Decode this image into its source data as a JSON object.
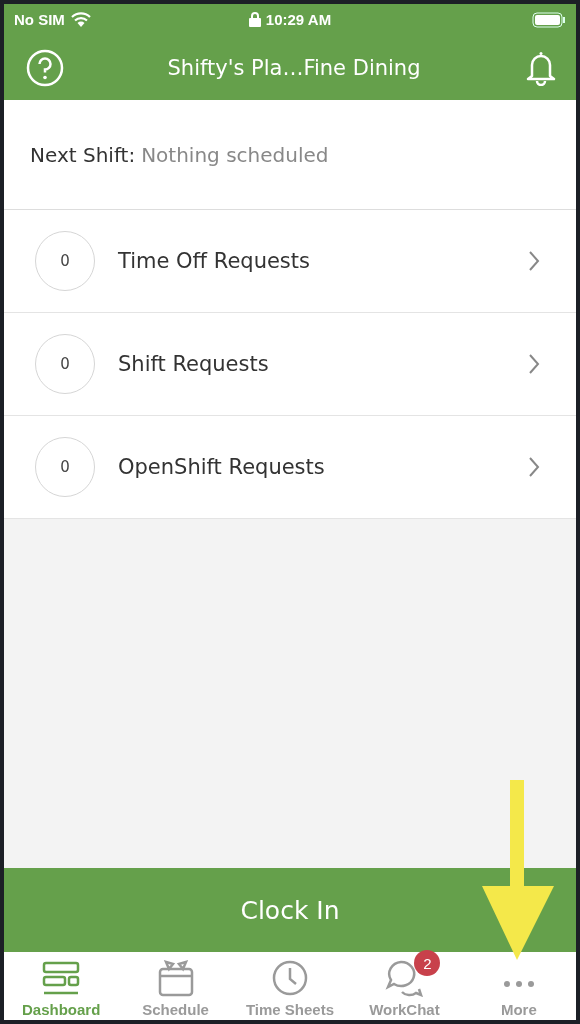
{
  "status_bar": {
    "carrier": "No SIM",
    "time": "10:29 AM"
  },
  "header": {
    "title": "Shifty's Pla…Fine Dining"
  },
  "next_shift": {
    "label": "Next Shift:",
    "value": "Nothing scheduled"
  },
  "requests": [
    {
      "count": "0",
      "label": "Time Off Requests"
    },
    {
      "count": "0",
      "label": "Shift Requests"
    },
    {
      "count": "0",
      "label": "OpenShift Requests"
    }
  ],
  "clock_in": {
    "label": "Clock In"
  },
  "tabs": [
    {
      "kind": "dashboard",
      "label": "Dashboard",
      "selected": true
    },
    {
      "kind": "schedule",
      "label": "Schedule",
      "selected": false
    },
    {
      "kind": "timesheets",
      "label": "Time Sheets",
      "selected": false
    },
    {
      "kind": "workchat",
      "label": "WorkChat",
      "selected": false,
      "badge": "2"
    },
    {
      "kind": "more",
      "label": "More",
      "selected": false
    }
  ]
}
